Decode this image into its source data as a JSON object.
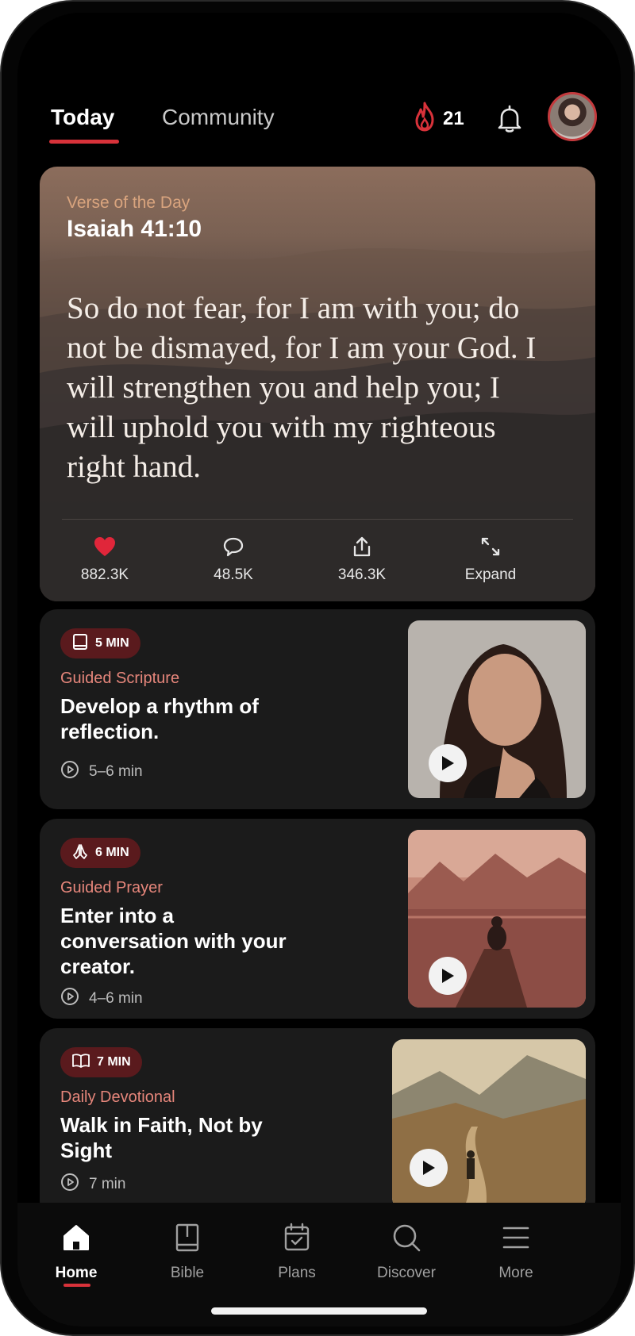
{
  "header": {
    "tabs": [
      {
        "label": "Today",
        "active": true
      },
      {
        "label": "Community",
        "active": false
      }
    ],
    "streak_count": "21",
    "accent": "#d8323a"
  },
  "verse": {
    "label": "Verse of the Day",
    "reference": "Isaiah 41:10",
    "text": "So do not fear, for I am with you; do not be dismayed, for I am your God. I will strengthen you and help you; I will uphold you with my righteous right hand.",
    "actions": [
      {
        "icon": "heart-icon",
        "label": "882.3K"
      },
      {
        "icon": "comment-icon",
        "label": "48.5K"
      },
      {
        "icon": "share-icon",
        "label": "346.3K"
      },
      {
        "icon": "expand-icon",
        "label": "Expand"
      }
    ]
  },
  "cards": [
    {
      "badge": "5 MIN",
      "badge_icon": "bookmark-book-icon",
      "category": "Guided Scripture",
      "title": "Develop a rhythm of reflection.",
      "duration": "5–6 min"
    },
    {
      "badge": "6 MIN",
      "badge_icon": "praying-hands-icon",
      "category": "Guided Prayer",
      "title": "Enter into a conversation with your creator.",
      "duration": "4–6 min"
    },
    {
      "badge": "7 MIN",
      "badge_icon": "open-book-icon",
      "category": "Daily Devotional",
      "title": "Walk in Faith, Not by Sight",
      "duration": "7 min"
    }
  ],
  "nav": [
    {
      "label": "Home",
      "icon": "home-icon",
      "active": true
    },
    {
      "label": "Bible",
      "icon": "bible-icon",
      "active": false
    },
    {
      "label": "Plans",
      "icon": "calendar-check-icon",
      "active": false
    },
    {
      "label": "Discover",
      "icon": "search-icon",
      "active": false
    },
    {
      "label": "More",
      "icon": "menu-icon",
      "active": false
    }
  ]
}
